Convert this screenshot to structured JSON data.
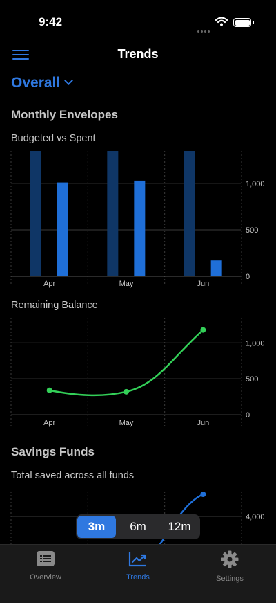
{
  "status": {
    "time": "9:42"
  },
  "nav": {
    "title": "Trends",
    "filter_label": "Overall"
  },
  "envelopes": {
    "heading": "Monthly Envelopes",
    "subheading": "Budgeted vs Spent"
  },
  "remaining": {
    "heading": "Remaining Balance"
  },
  "savings": {
    "heading": "Savings Funds",
    "subheading": "Total saved across all funds"
  },
  "chart_data": [
    {
      "type": "bar",
      "title": "Budgeted vs Spent",
      "categories": [
        "Apr",
        "May",
        "Jun"
      ],
      "series": [
        {
          "values": [
            1350,
            1350,
            1350
          ]
        },
        {
          "values": [
            1010,
            1030,
            170
          ]
        }
      ],
      "ylim": [
        0,
        1350
      ],
      "yticks": [
        0,
        500,
        1000
      ],
      "ytick_labels": [
        "0",
        "500",
        "1,000"
      ],
      "colors": [
        "#0f3666",
        "#1f6fd8"
      ],
      "grid": true
    },
    {
      "type": "line",
      "title": "Remaining Balance",
      "categories": [
        "Apr",
        "May",
        "Jun"
      ],
      "series": [
        {
          "values": [
            340,
            320,
            1180
          ]
        }
      ],
      "ylim": [
        0,
        1350
      ],
      "yticks": [
        0,
        500,
        1000
      ],
      "ytick_labels": [
        "0",
        "500",
        "1,000"
      ],
      "colors": [
        "#33d058"
      ],
      "grid": true
    },
    {
      "type": "line",
      "title": "Total saved across all funds",
      "categories": [
        "Apr",
        "May",
        "Jun"
      ],
      "series": [
        {
          "values": [
            3820,
            3870,
            4050
          ]
        }
      ],
      "yticks": [
        4000
      ],
      "ytick_labels": [
        "4,000"
      ],
      "colors": [
        "#1f6fd8"
      ],
      "grid": true
    }
  ],
  "range_selector": {
    "options": [
      "3m",
      "6m",
      "12m"
    ],
    "selected": "3m"
  },
  "tabs": [
    {
      "label": "Overview",
      "icon": "list-icon",
      "active": false
    },
    {
      "label": "Trends",
      "icon": "chart-icon",
      "active": true
    },
    {
      "label": "Settings",
      "icon": "gear-icon",
      "active": false
    }
  ]
}
